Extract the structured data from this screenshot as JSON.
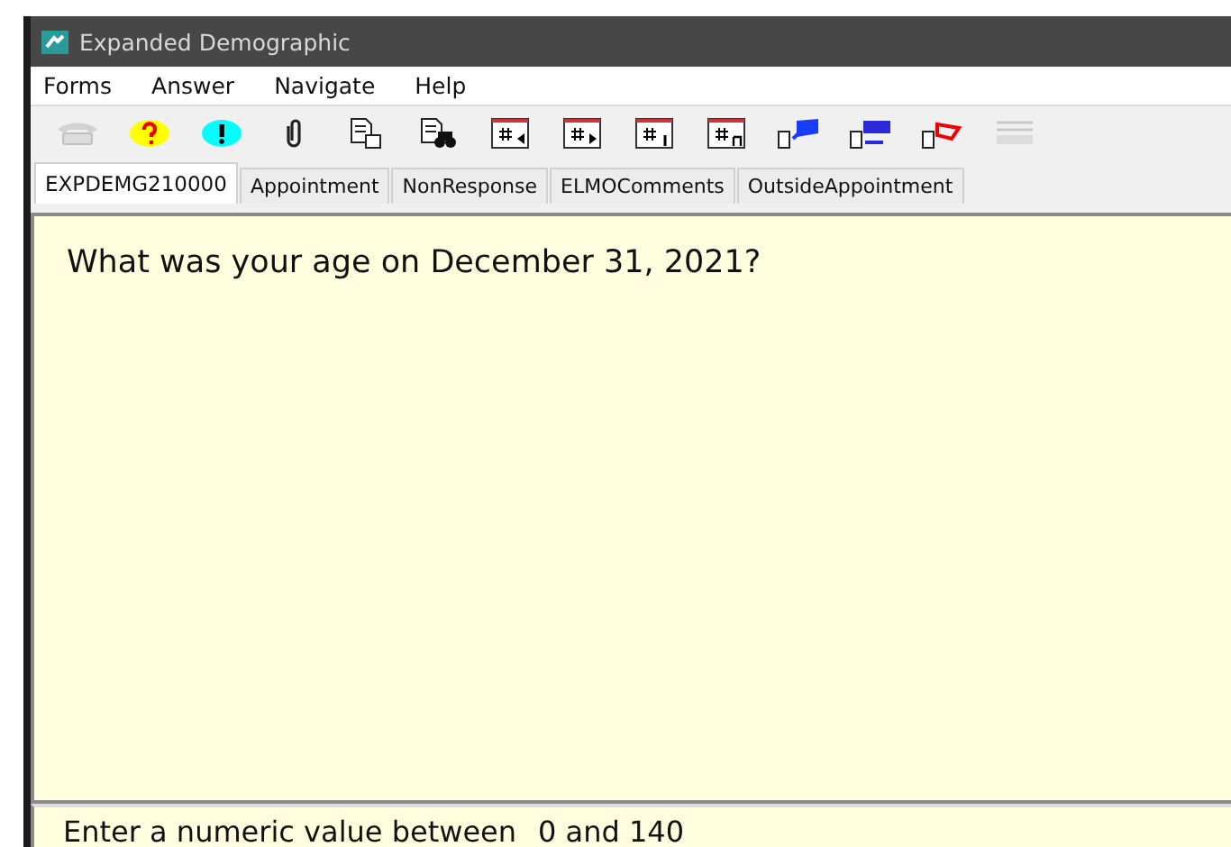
{
  "window": {
    "title": "Expanded Demographic"
  },
  "menu": [
    "Forms",
    "Answer",
    "Navigate",
    "Help"
  ],
  "toolbar": [
    {
      "kind": "phone",
      "disabled": true
    },
    {
      "kind": "help"
    },
    {
      "kind": "alert"
    },
    {
      "kind": "clip"
    },
    {
      "kind": "copy"
    },
    {
      "kind": "find"
    },
    {
      "kind": "field-back"
    },
    {
      "kind": "field-next"
    },
    {
      "kind": "field-first"
    },
    {
      "kind": "field-last"
    },
    {
      "kind": "flag-blue"
    },
    {
      "kind": "flag-navy"
    },
    {
      "kind": "flag-red"
    },
    {
      "kind": "lines",
      "disabled": true
    }
  ],
  "tabs": [
    {
      "label": "EXPDEMG210000",
      "selected": true
    },
    {
      "label": "Appointment",
      "selected": false
    },
    {
      "label": "NonResponse",
      "selected": false
    },
    {
      "label": "ELMOComments",
      "selected": false
    },
    {
      "label": "OutsideAppointment",
      "selected": false
    }
  ],
  "question": "What was your age on December 31, 2021?",
  "status_bar": {
    "hint": "Enter a numeric value between",
    "range": "0 and 140"
  }
}
